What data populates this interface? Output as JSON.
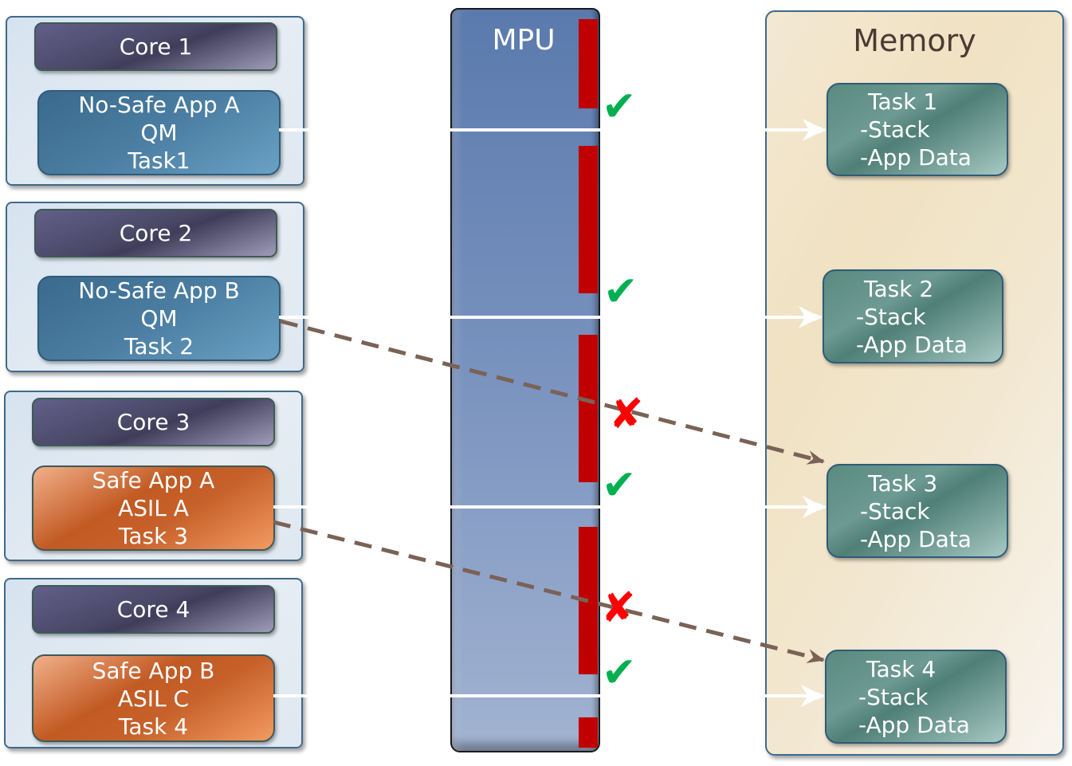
{
  "mpu": {
    "title": "MPU"
  },
  "memory": {
    "title": "Memory",
    "tasks": [
      {
        "title": "Task 1",
        "lines": [
          "-Stack",
          "-App Data"
        ]
      },
      {
        "title": "Task 2",
        "lines": [
          "-Stack",
          "-App Data"
        ]
      },
      {
        "title": "Task 3",
        "lines": [
          "-Stack",
          "-App Data"
        ]
      },
      {
        "title": "Task 4",
        "lines": [
          "-Stack",
          "-App Data"
        ]
      }
    ]
  },
  "cores": [
    {
      "label": "Core 1",
      "app": {
        "name": "No-Safe App A",
        "level": "QM",
        "task": "Task1",
        "kind": "qm"
      }
    },
    {
      "label": "Core 2",
      "app": {
        "name": "No-Safe App B",
        "level": "QM",
        "task": "Task 2",
        "kind": "qm"
      }
    },
    {
      "label": "Core 3",
      "app": {
        "name": "Safe App A",
        "level": "ASIL A",
        "task": "Task 3",
        "kind": "asil"
      }
    },
    {
      "label": "Core 4",
      "app": {
        "name": "Safe App B",
        "level": "ASIL C",
        "task": "Task 4",
        "kind": "asil"
      }
    }
  ],
  "accesses": [
    {
      "from": "Task1",
      "to": "Task 1",
      "style": "allowed",
      "result": "check-icon"
    },
    {
      "from": "Task 2",
      "to": "Task 2",
      "style": "allowed",
      "result": "check-icon"
    },
    {
      "from": "Task 2",
      "to": "Task 3",
      "style": "blocked",
      "result": "cross-icon"
    },
    {
      "from": "Task 3",
      "to": "Task 3",
      "style": "allowed",
      "result": "check-icon"
    },
    {
      "from": "Task 3",
      "to": "Task 4",
      "style": "blocked",
      "result": "cross-icon"
    },
    {
      "from": "Task 4",
      "to": "Task 4",
      "style": "allowed",
      "result": "check-icon"
    }
  ],
  "marks": {
    "check": "✔",
    "cross": "✘"
  },
  "colors": {
    "allowed_mark": "#00b050",
    "blocked_mark": "#ff0000",
    "mpu_region": "#c00000",
    "blocked_arrow": "#7a6256",
    "allowed_glow": "#ff6b6b"
  }
}
